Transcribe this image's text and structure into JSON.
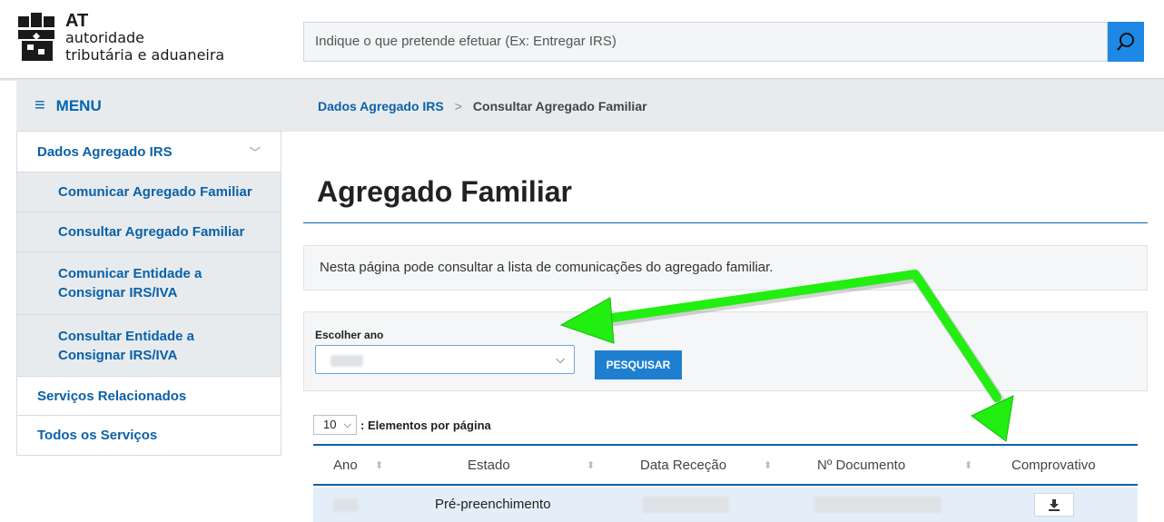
{
  "header": {
    "logo": {
      "acronym": "AT",
      "line1": "autoridade",
      "line2": "tributária e aduaneira"
    },
    "search_placeholder": "Indique o que pretende efetuar (Ex: Entregar IRS)",
    "search_icon": "search-icon"
  },
  "sidebar": {
    "menu_label": "MENU",
    "items": [
      {
        "label": "Dados Agregado IRS",
        "level": 0
      },
      {
        "label": "Comunicar Agregado Familiar",
        "level": 1
      },
      {
        "label": "Consultar Agregado Familiar",
        "level": 1
      },
      {
        "label": "Comunicar Entidade a Consignar IRS/IVA",
        "level": 1
      },
      {
        "label": "Consultar Entidade a Consignar IRS/IVA",
        "level": 1
      },
      {
        "label": "Serviços Relacionados",
        "level": 0
      },
      {
        "label": "Todos os Serviços",
        "level": 0
      }
    ]
  },
  "breadcrumb": {
    "parent": "Dados Agregado IRS",
    "separator": ">",
    "current": "Consultar Agregado Familiar"
  },
  "main": {
    "title": "Agregado Familiar",
    "info": "Nesta página pode consultar a lista de comunicações do agregado familiar.",
    "filter": {
      "label": "Escolher ano",
      "search_button": "PESQUISAR"
    },
    "per_page": {
      "value": "10",
      "label": ": Elementos por página"
    },
    "table": {
      "headers": [
        "Ano",
        "Estado",
        "Data Receção",
        "Nº Documento",
        "Comprovativo"
      ],
      "rows": [
        {
          "estado": "Pré-preenchimento"
        }
      ]
    }
  },
  "colors": {
    "brand_blue": "#0b61a8",
    "button_blue": "#1e7fd0",
    "annotation_green": "#22ee11"
  }
}
